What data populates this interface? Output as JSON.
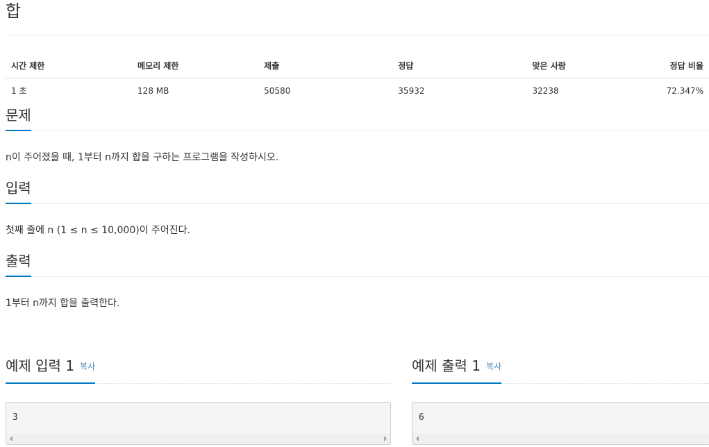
{
  "problem": {
    "title": "합"
  },
  "info_table": {
    "headers": [
      "시간 제한",
      "메모리 제한",
      "제출",
      "정답",
      "맞은 사람",
      "정답 비율"
    ],
    "values": [
      "1 초",
      "128 MB",
      "50580",
      "35932",
      "32238",
      "72.347%"
    ]
  },
  "sections": {
    "description": {
      "heading": "문제",
      "text": "n이 주어졌을 때, 1부터 n까지 합을 구하는 프로그램을 작성하시오."
    },
    "input": {
      "heading": "입력",
      "text": "첫째 줄에 n (1 ≤ n ≤ 10,000)이 주어진다."
    },
    "output": {
      "heading": "출력",
      "text": "1부터 n까지 합을 출력한다."
    }
  },
  "samples": {
    "input": {
      "heading": "예제 입력 1",
      "copy_label": "복사",
      "content": "3"
    },
    "output": {
      "heading": "예제 출력 1",
      "copy_label": "복사",
      "content": "6"
    }
  },
  "colors": {
    "accent_underline": "#0076c0",
    "copy_link": "#428bca",
    "sample_bg": "#f5f5f5"
  }
}
